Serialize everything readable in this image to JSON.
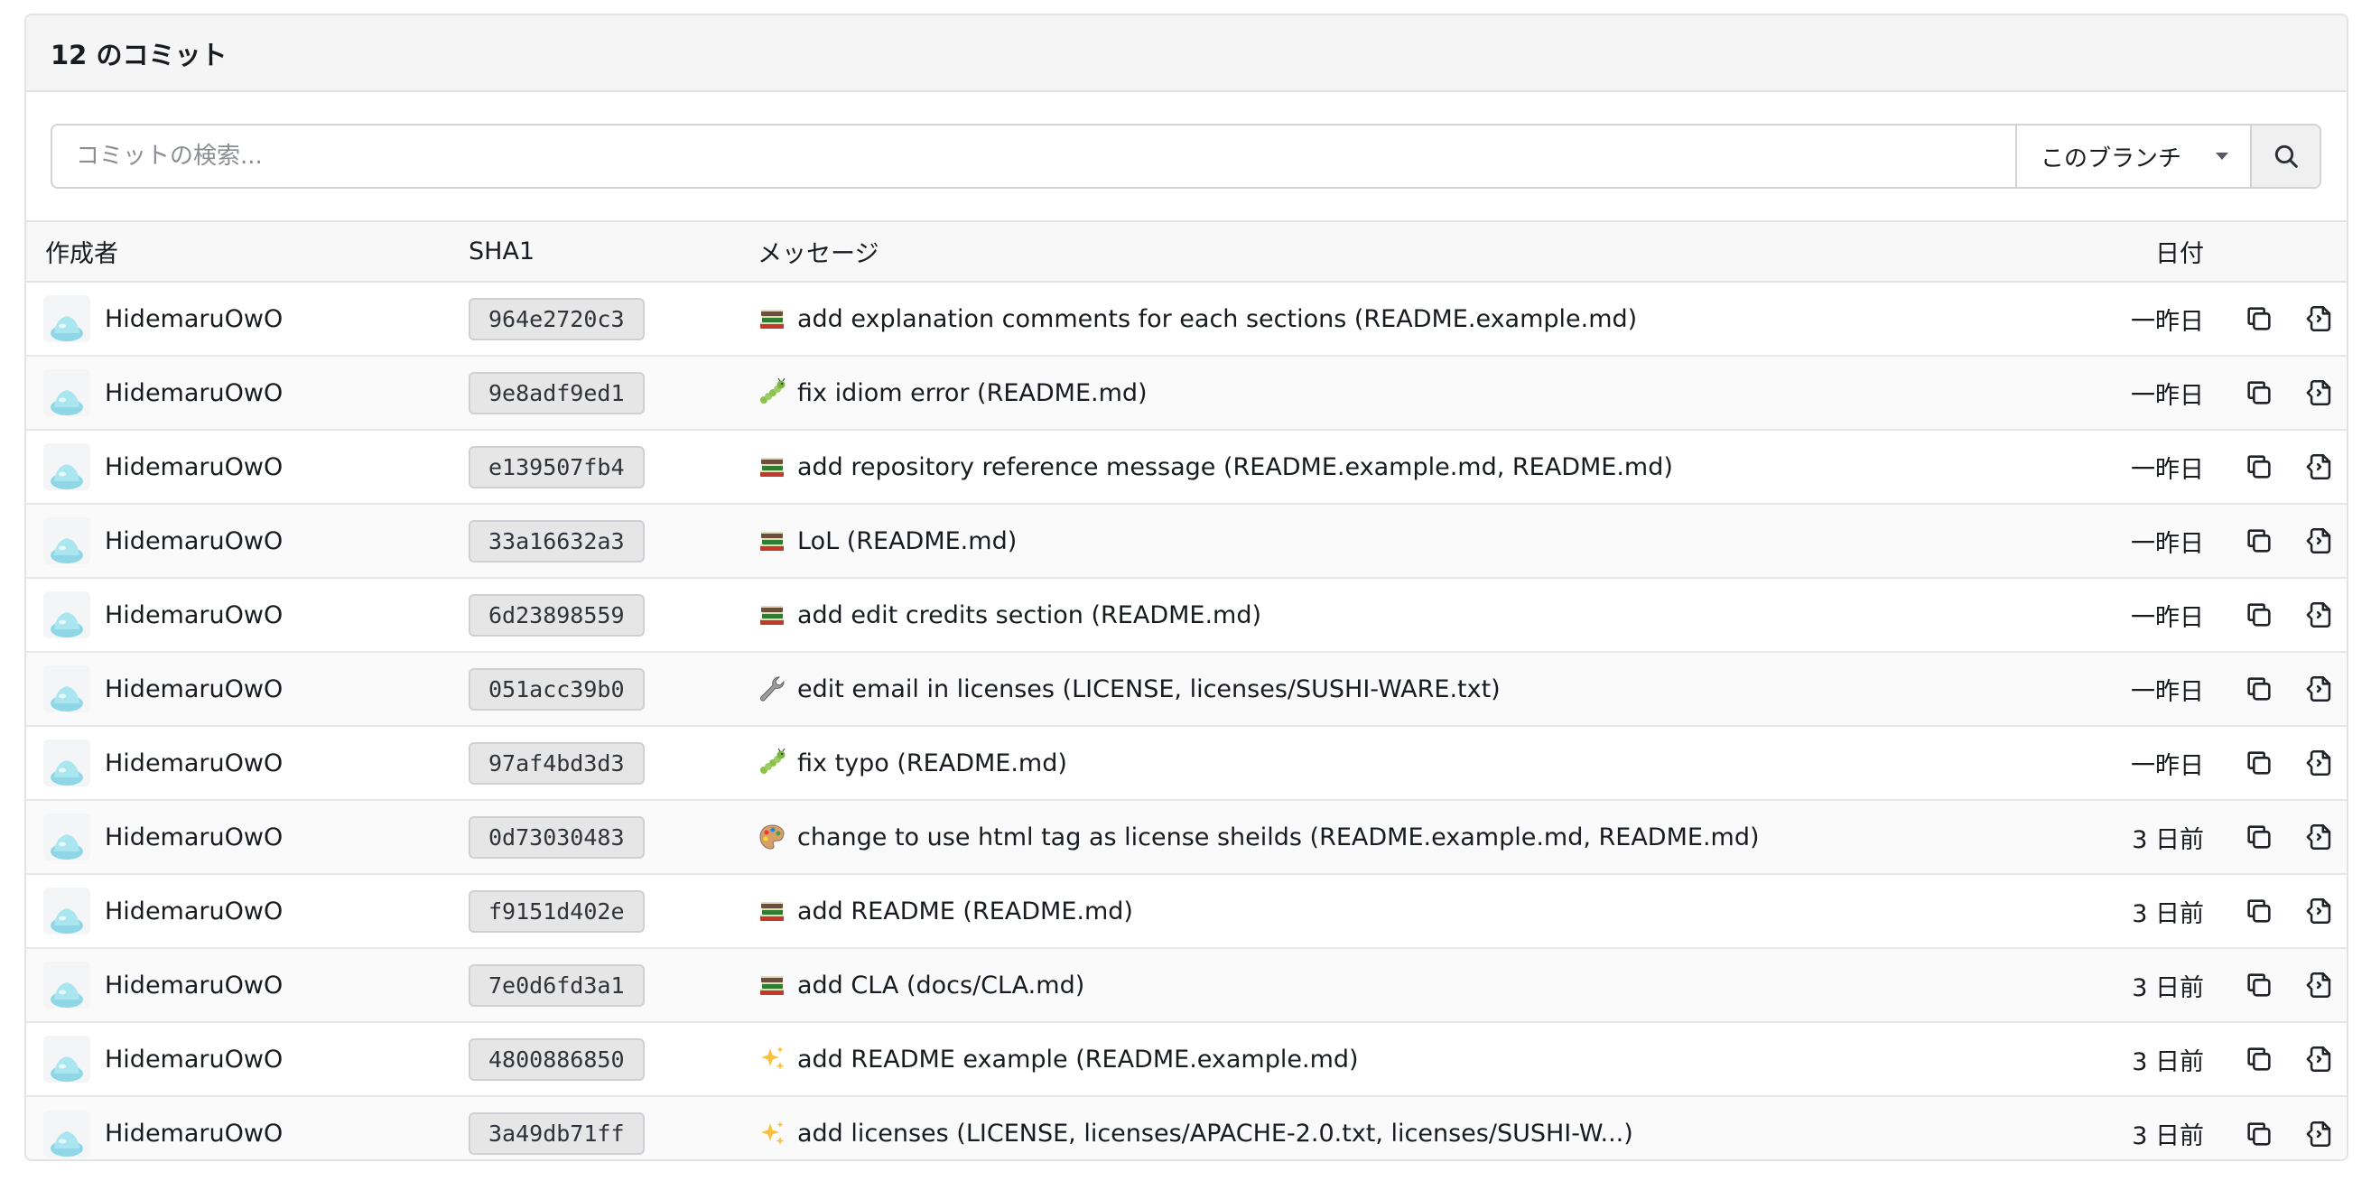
{
  "header": {
    "title": "12 のコミット"
  },
  "search": {
    "placeholder": "コミットの検索...",
    "branch_label": "このブランチ",
    "button_icon": "search-icon"
  },
  "table": {
    "columns": {
      "author": "作成者",
      "sha": "SHA1",
      "message": "メッセージ",
      "date": "日付"
    },
    "rows": [
      {
        "author": "HidemaruOwO",
        "sha": "964e2720c3",
        "emoji": "books",
        "message": "add explanation comments for each sections (README.example.md)",
        "date": "一昨日"
      },
      {
        "author": "HidemaruOwO",
        "sha": "9e8adf9ed1",
        "emoji": "caterpillar",
        "message": "fix idiom error (README.md)",
        "date": "一昨日"
      },
      {
        "author": "HidemaruOwO",
        "sha": "e139507fb4",
        "emoji": "books",
        "message": "add repository reference message (README.example.md, README.md)",
        "date": "一昨日"
      },
      {
        "author": "HidemaruOwO",
        "sha": "33a16632a3",
        "emoji": "books",
        "message": "LoL (README.md)",
        "date": "一昨日"
      },
      {
        "author": "HidemaruOwO",
        "sha": "6d23898559",
        "emoji": "books",
        "message": "add edit credits section (README.md)",
        "date": "一昨日"
      },
      {
        "author": "HidemaruOwO",
        "sha": "051acc39b0",
        "emoji": "wrench",
        "message": "edit email in licenses (LICENSE, licenses/SUSHI-WARE.txt)",
        "date": "一昨日"
      },
      {
        "author": "HidemaruOwO",
        "sha": "97af4bd3d3",
        "emoji": "caterpillar",
        "message": "fix typo (README.md)",
        "date": "一昨日"
      },
      {
        "author": "HidemaruOwO",
        "sha": "0d73030483",
        "emoji": "palette",
        "message": "change to use html tag as license sheilds (README.example.md, README.md)",
        "date": "3 日前"
      },
      {
        "author": "HidemaruOwO",
        "sha": "f9151d402e",
        "emoji": "books",
        "message": "add README (README.md)",
        "date": "3 日前"
      },
      {
        "author": "HidemaruOwO",
        "sha": "7e0d6fd3a1",
        "emoji": "books",
        "message": "add CLA (docs/CLA.md)",
        "date": "3 日前"
      },
      {
        "author": "HidemaruOwO",
        "sha": "4800886850",
        "emoji": "sparkles",
        "message": "add README example (README.example.md)",
        "date": "3 日前"
      },
      {
        "author": "HidemaruOwO",
        "sha": "3a49db71ff",
        "emoji": "sparkles",
        "message": "add licenses (LICENSE, licenses/APACHE-2.0.txt, licenses/SUSHI-W...)",
        "date": "3 日前"
      }
    ]
  },
  "icons": {
    "copy": "copy-icon",
    "browse": "browse-files-icon"
  },
  "colors": {
    "header_bg": "#f5f5f5",
    "border": "#e2e3e5",
    "sha_bg": "#e6e6e7"
  }
}
